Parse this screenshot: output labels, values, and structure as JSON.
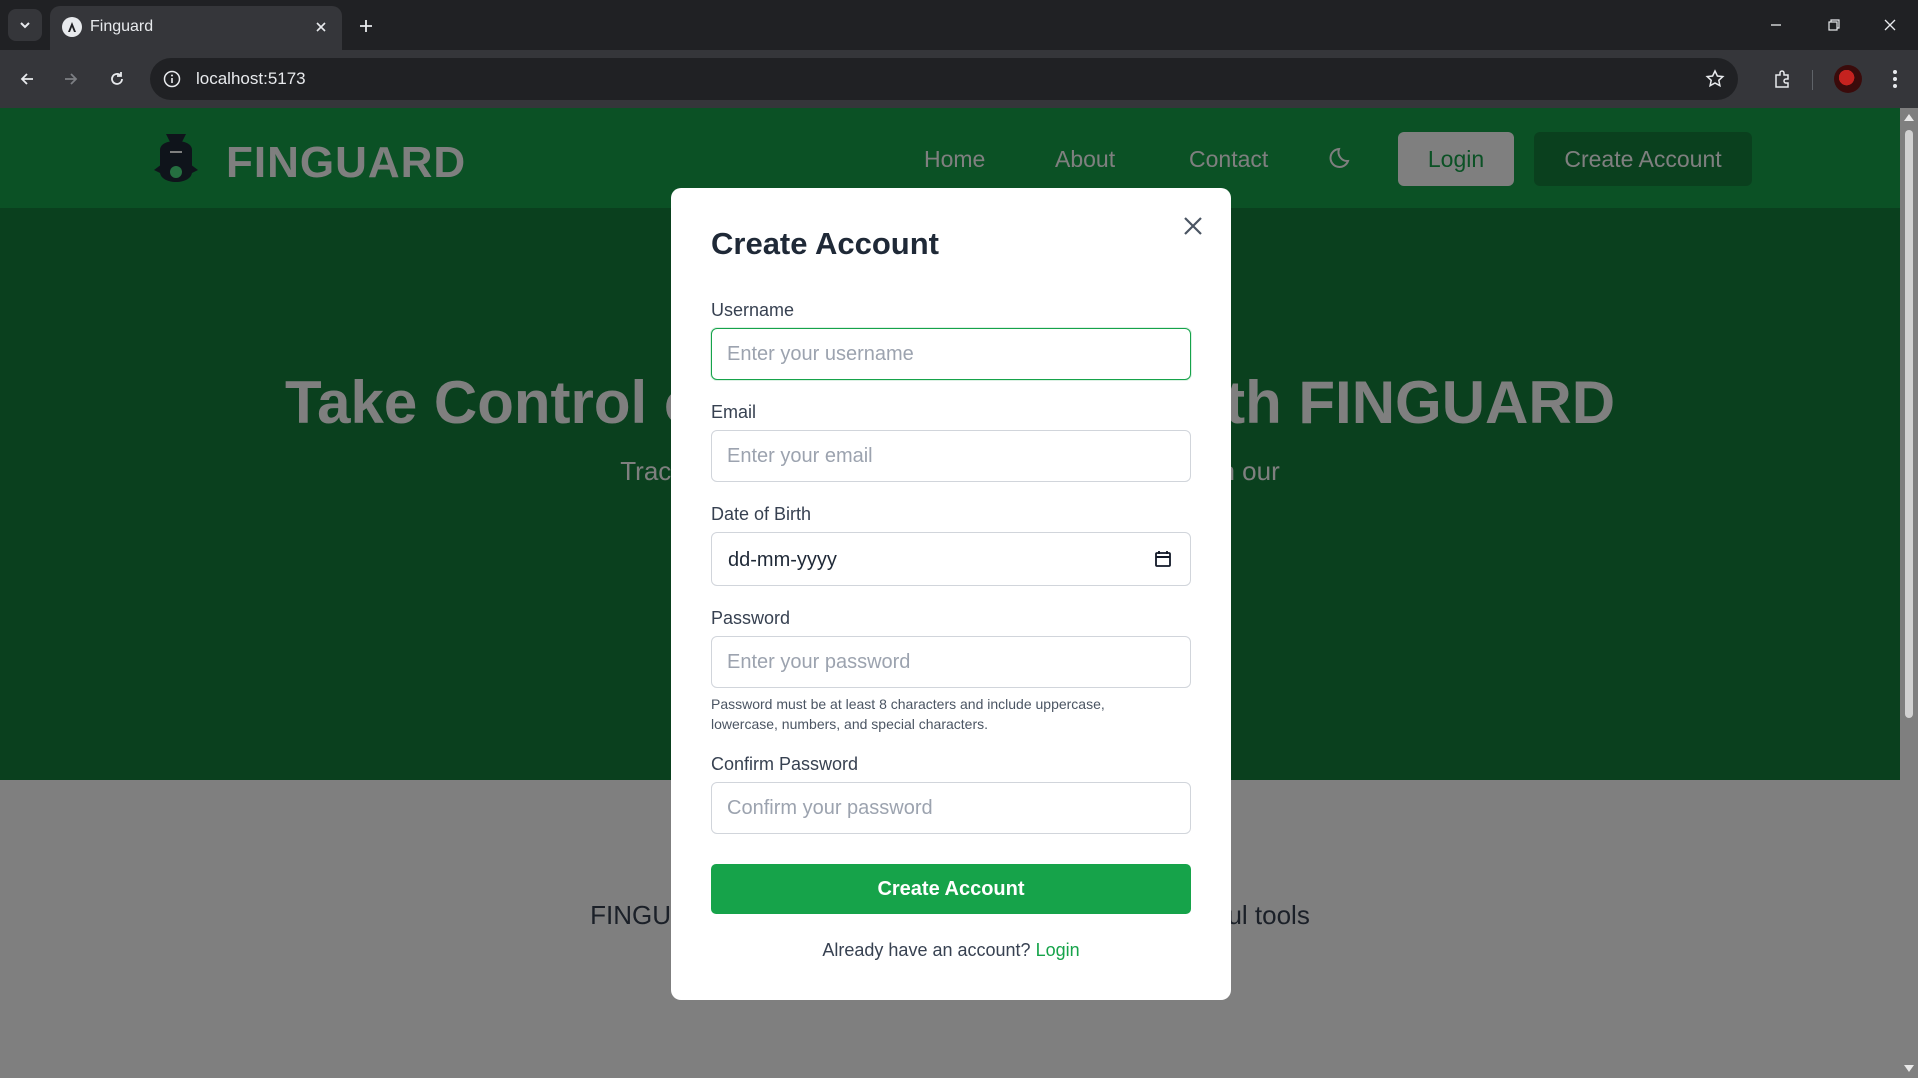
{
  "browser": {
    "tab_title": "Finguard",
    "url": "localhost:5173"
  },
  "site": {
    "brand": "FINGUARD",
    "nav_links": [
      "Home",
      "About",
      "Contact"
    ],
    "login_label": "Login",
    "create_account_label": "Create Account",
    "hero_title": "Take Control of Your Finances with FINGUARD",
    "hero_subtitle": "Track your income, expenses, and savings goals with our",
    "about_text": "FINGUARD helps you manage your money with powerful tools"
  },
  "modal": {
    "title": "Create Account",
    "fields": {
      "username": {
        "label": "Username",
        "placeholder": "Enter your username"
      },
      "email": {
        "label": "Email",
        "placeholder": "Enter your email"
      },
      "dob": {
        "label": "Date of Birth",
        "value": "dd-mm-yyyy"
      },
      "password": {
        "label": "Password",
        "placeholder": "Enter your password"
      },
      "confirm": {
        "label": "Confirm Password",
        "placeholder": "Confirm your password"
      }
    },
    "password_hint": "Password must be at least 8 characters and include uppercase, lowercase, numbers, and special characters.",
    "submit_label": "Create Account",
    "switch_prompt": "Already have an account?",
    "switch_link": "Login"
  },
  "colors": {
    "nav_green": "#16a34a",
    "hero_green": "#15803d",
    "accent": "#16a34a"
  },
  "icons": {
    "tab_menu": "chevron-down-icon",
    "close": "close-icon",
    "theme": "moon-icon",
    "calendar": "calendar-icon"
  }
}
